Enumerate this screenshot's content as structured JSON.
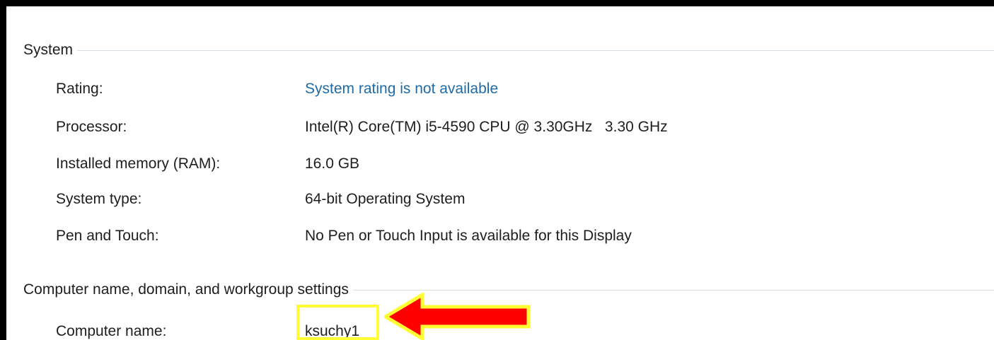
{
  "system_group": {
    "title": "System",
    "rows": [
      {
        "label": "Rating:",
        "value": "System rating is not available"
      },
      {
        "label": "Processor:",
        "value": "Intel(R) Core(TM) i5-4590 CPU @ 3.30GHz   3.30 GHz"
      },
      {
        "label": "Installed memory (RAM):",
        "value": "16.0 GB"
      },
      {
        "label": "System type:",
        "value": "64-bit Operating System"
      },
      {
        "label": "Pen and Touch:",
        "value": "No Pen or Touch Input is available for this Display"
      }
    ]
  },
  "computer_group": {
    "title": "Computer name, domain, and workgroup settings",
    "rows": [
      {
        "label": "Computer name:",
        "value": "ksuchy1"
      }
    ]
  },
  "colors": {
    "link": "#1e6ba8",
    "frame": "#000000",
    "highlight": "#ffff33",
    "arrow_fill": "#ff0000",
    "arrow_outline": "#ffff33"
  },
  "icons": {
    "annotation_arrow": "left-arrow-icon"
  }
}
